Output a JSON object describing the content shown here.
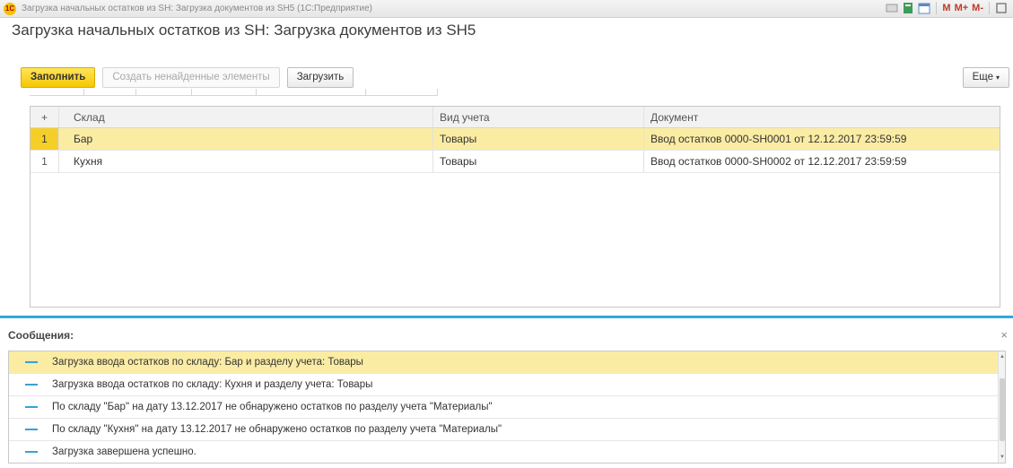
{
  "window": {
    "title": "Загрузка начальных остатков из SH: Загрузка документов из SH5  (1С:Предприятие)",
    "logo_text": "1С",
    "memory_labels": {
      "m": "M",
      "m_plus": "M+",
      "m_minus": "M-"
    }
  },
  "form": {
    "title": "Загрузка начальных остатков из SH: Загрузка документов из SH5"
  },
  "toolbar": {
    "fill_label": "Заполнить",
    "create_missing_label": "Создать ненайденные элементы",
    "load_label": "Загрузить",
    "more_label": "Еще",
    "more_caret": "▾"
  },
  "table": {
    "headers": {
      "num": "+",
      "sklad": "Склад",
      "vid": "Вид учета",
      "doc": "Документ"
    },
    "rows": [
      {
        "num": "1",
        "sklad": "Бар",
        "vid": "Товары",
        "doc": "Ввод остатков 0000-SH0001 от 12.12.2017 23:59:59",
        "selected": true
      },
      {
        "num": "1",
        "sklad": "Кухня",
        "vid": "Товары",
        "doc": "Ввод остатков 0000-SH0002 от 12.12.2017 23:59:59",
        "selected": false
      }
    ]
  },
  "messages": {
    "title": "Сообщения:",
    "close_glyph": "×",
    "items": [
      {
        "text": "Загрузка ввода остатков по складу: Бар и разделу учета: Товары",
        "selected": true
      },
      {
        "text": "Загрузка ввода остатков по складу: Кухня и разделу учета: Товары",
        "selected": false
      },
      {
        "text": "По складу \"Бар\" на дату 13.12.2017 не обнаружено остатков по разделу учета \"Материалы\"",
        "selected": false
      },
      {
        "text": "По складу \"Кухня\" на дату 13.12.2017 не обнаружено остатков по разделу учета \"Материалы\"",
        "selected": false
      },
      {
        "text": "Загрузка завершена успешно.",
        "selected": false
      }
    ]
  },
  "colors": {
    "accent_yellow": "#f5cf28",
    "selected_row": "#fbeca4",
    "separator_blue": "#2fa7e0"
  }
}
